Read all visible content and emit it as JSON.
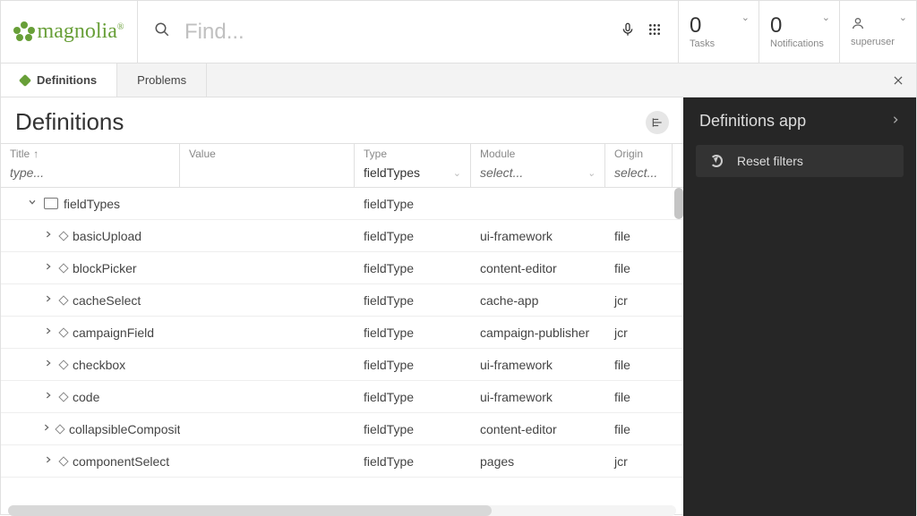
{
  "header": {
    "logo_text": "magnolia",
    "logo_mark": "®",
    "search_placeholder": "Find...",
    "tasks": {
      "count": "0",
      "label": "Tasks"
    },
    "notifications": {
      "count": "0",
      "label": "Notifications"
    },
    "user": {
      "name": "superuser"
    }
  },
  "tabs": {
    "active": "Definitions",
    "inactive": "Problems"
  },
  "page": {
    "title": "Definitions"
  },
  "columns": {
    "title": "Title",
    "value": "Value",
    "type": "Type",
    "module": "Module",
    "origin": "Origin"
  },
  "filters": {
    "title_placeholder": "type...",
    "value_placeholder": "",
    "type_value": "fieldTypes",
    "module_placeholder": "select...",
    "origin_placeholder": "select..."
  },
  "tree": [
    {
      "level": 1,
      "expanded": true,
      "kind": "folder",
      "title": "fieldTypes",
      "type": "fieldType",
      "module": "",
      "origin": ""
    },
    {
      "level": 2,
      "expanded": false,
      "kind": "node",
      "title": "basicUpload",
      "type": "fieldType",
      "module": "ui-framework",
      "origin": "file"
    },
    {
      "level": 2,
      "expanded": false,
      "kind": "node",
      "title": "blockPicker",
      "type": "fieldType",
      "module": "content-editor",
      "origin": "file"
    },
    {
      "level": 2,
      "expanded": false,
      "kind": "node",
      "title": "cacheSelect",
      "type": "fieldType",
      "module": "cache-app",
      "origin": "jcr"
    },
    {
      "level": 2,
      "expanded": false,
      "kind": "node",
      "title": "campaignField",
      "type": "fieldType",
      "module": "campaign-publisher",
      "origin": "jcr"
    },
    {
      "level": 2,
      "expanded": false,
      "kind": "node",
      "title": "checkbox",
      "type": "fieldType",
      "module": "ui-framework",
      "origin": "file"
    },
    {
      "level": 2,
      "expanded": false,
      "kind": "node",
      "title": "code",
      "type": "fieldType",
      "module": "ui-framework",
      "origin": "file"
    },
    {
      "level": 2,
      "expanded": false,
      "kind": "node",
      "title": "collapsibleComposite",
      "type": "fieldType",
      "module": "content-editor",
      "origin": "file"
    },
    {
      "level": 2,
      "expanded": false,
      "kind": "node",
      "title": "componentSelect",
      "type": "fieldType",
      "module": "pages",
      "origin": "jcr"
    }
  ],
  "sidebar": {
    "title": "Definitions app",
    "reset_label": "Reset filters"
  }
}
